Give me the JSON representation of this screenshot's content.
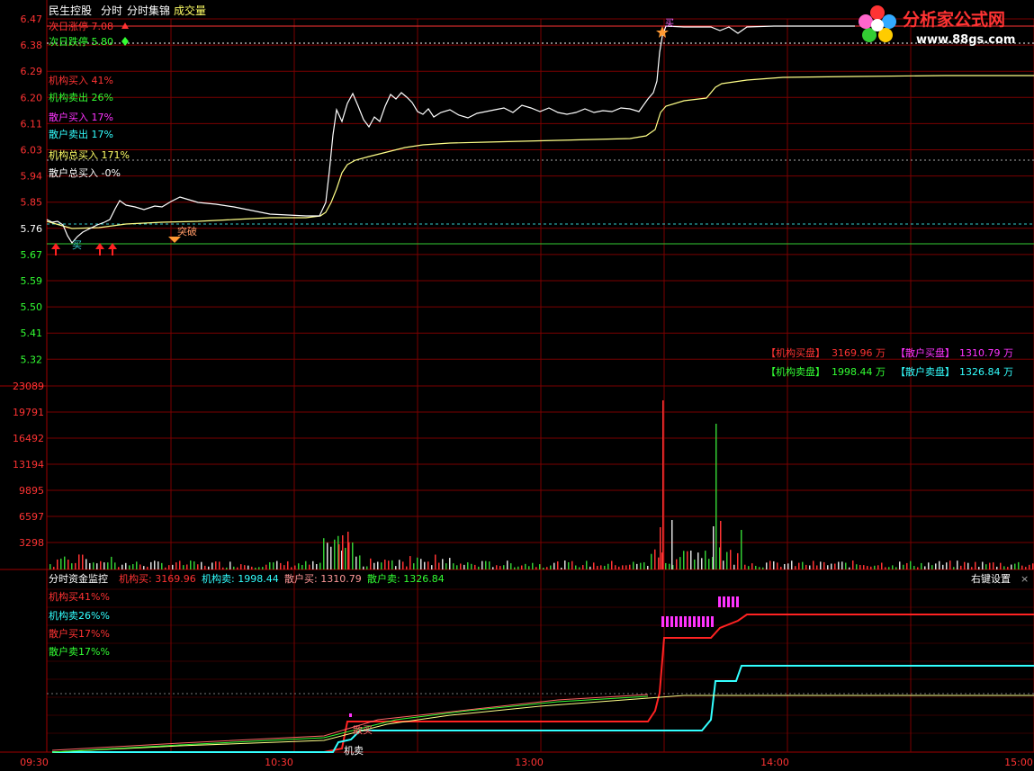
{
  "header": {
    "stock_name": "民生控股",
    "tab_fenshi": "分时",
    "tab_jijin": "分时集锦",
    "tab_volume": "成交量"
  },
  "logo": {
    "text": "分析家公式网",
    "url": "www.88gs.com"
  },
  "price_panel": {
    "y_ticks": [
      "6.47",
      "6.38",
      "6.29",
      "6.20",
      "6.11",
      "6.03",
      "5.94",
      "5.85",
      "5.76",
      "5.67",
      "5.59",
      "5.50",
      "5.41",
      "5.32"
    ],
    "indicators": [
      {
        "label": "次日涨停 7.08",
        "color": "#ff3333",
        "marker": "triangle-up"
      },
      {
        "label": "次日跌停 5.80",
        "color": "#33ff33",
        "marker": "diamond"
      },
      {
        "label": "机构买入 41%",
        "color": "#ff3333"
      },
      {
        "label": "机构卖出 26%",
        "color": "#33ff33"
      },
      {
        "label": "散户买入 17%",
        "color": "#ff33ff"
      },
      {
        "label": "散户卖出 17%",
        "color": "#33ffff"
      },
      {
        "label": "机构总买入 171%",
        "color": "#ffff66"
      },
      {
        "label": "散户总买入 -0%",
        "color": "#ffffff"
      }
    ],
    "annotations": {
      "buy": "买",
      "breakout": "突破",
      "top_buy": "买"
    }
  },
  "volume_panel": {
    "y_ticks": [
      "23089",
      "19791",
      "16492",
      "13194",
      "9895",
      "6597",
      "3298"
    ],
    "summary": {
      "inst_buy_label": "【机构买盘】",
      "inst_buy_value": "3169.96 万",
      "retail_buy_label": "【散户买盘】",
      "retail_buy_value": "1310.79 万",
      "inst_sell_label": "【机构卖盘】",
      "inst_sell_value": "1998.44 万",
      "retail_sell_label": "【散户卖盘】",
      "retail_sell_value": "1326.84 万"
    }
  },
  "monitor_panel": {
    "title": "分时资金监控",
    "inst_buy": "机构买: 3169.96",
    "inst_sell": "机构卖: 1998.44",
    "retail_buy": "散户买: 1310.79",
    "retail_sell": "散户卖: 1326.84",
    "right_settings": "右键设置",
    "close": "×",
    "legend": [
      {
        "label": "机构买41%%",
        "color": "#ff3333"
      },
      {
        "label": "机构卖26%%",
        "color": "#33ffff"
      },
      {
        "label": "散户买17%%",
        "color": "#ff3333"
      },
      {
        "label": "散户卖17%%",
        "color": "#33ff33"
      }
    ],
    "annotations": {
      "retail_buy": "散买",
      "inst_sell": "机卖"
    }
  },
  "time_axis": [
    "09:30",
    "10:30",
    "13:00",
    "14:00",
    "15:00"
  ],
  "chart_data": {
    "type": "line",
    "title": "民生控股",
    "x": [
      "09:30",
      "10:30",
      "13:00",
      "14:00",
      "15:00"
    ],
    "ylim": [
      5.32,
      6.47
    ],
    "limit_up_next": 7.08,
    "limit_down_next": 5.8,
    "series": [
      {
        "name": "分时",
        "values_approx": [
          5.8,
          5.76,
          5.85,
          5.82,
          6.2,
          6.15,
          6.13,
          6.47,
          6.47,
          6.47
        ]
      },
      {
        "name": "均价",
        "values_approx": [
          5.78,
          5.79,
          5.8,
          5.81,
          6.05,
          6.09,
          6.1,
          6.2,
          6.26,
          6.27
        ]
      }
    ],
    "volume_ylim": [
      0,
      23089
    ],
    "volume_peaks": [
      {
        "time": "14:00",
        "value": 21000
      },
      {
        "time": "14:10",
        "value": 18500
      }
    ],
    "colors": {
      "price": "#ffffff",
      "avg": "#ffff88",
      "inst_buy": "#ff2222",
      "inst_sell": "#33ffff",
      "grid": "#8b0000",
      "up": "#ff3333",
      "down": "#33ff33"
    }
  }
}
